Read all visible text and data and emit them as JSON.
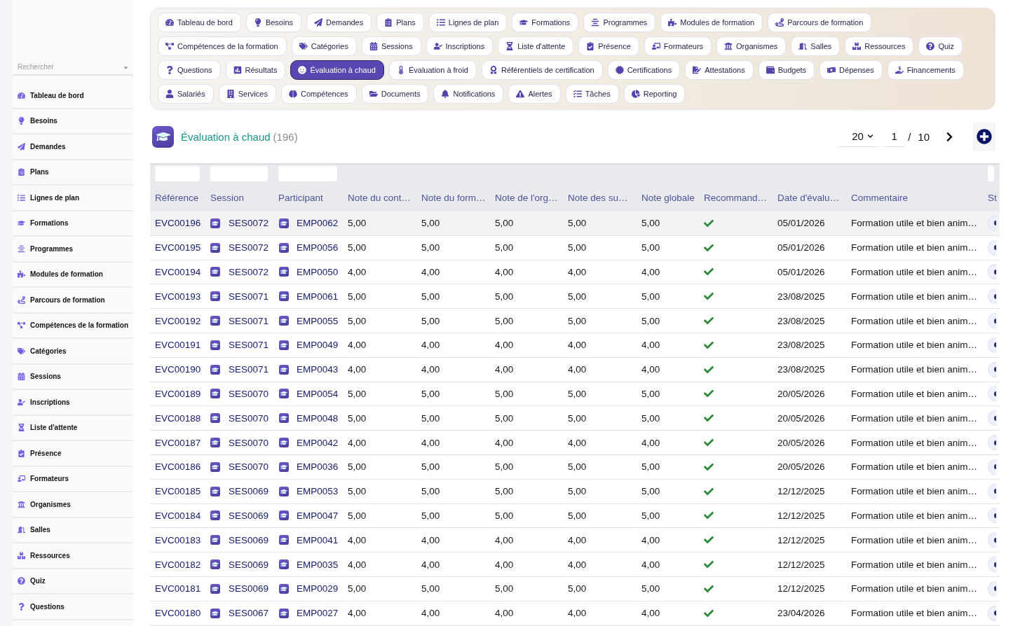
{
  "sidebar": {
    "search": {
      "placeholder": "Rechercher"
    },
    "items": [
      {
        "label": "Tableau de bord",
        "selected": false
      },
      {
        "label": "Besoins",
        "selected": false
      },
      {
        "label": "Demandes",
        "selected": false
      },
      {
        "label": "Plans",
        "selected": false
      },
      {
        "label": "Lignes de plan",
        "selected": false
      },
      {
        "label": "Formations",
        "selected": false
      },
      {
        "label": "Programmes",
        "selected": false
      },
      {
        "label": "Modules de formation",
        "selected": false
      },
      {
        "label": "Parcours de formation",
        "selected": false
      },
      {
        "label": "Compétences de la formation",
        "selected": false
      },
      {
        "label": "Catégories",
        "selected": false
      },
      {
        "label": "Sessions",
        "selected": false
      },
      {
        "label": "Inscriptions",
        "selected": false
      },
      {
        "label": "Liste d'attente",
        "selected": false
      },
      {
        "label": "Présence",
        "selected": false
      },
      {
        "label": "Formateurs",
        "selected": false
      },
      {
        "label": "Organismes",
        "selected": false
      },
      {
        "label": "Salles",
        "selected": false
      },
      {
        "label": "Ressources",
        "selected": false
      },
      {
        "label": "Quiz",
        "selected": false
      },
      {
        "label": "Questions",
        "selected": false
      }
    ]
  },
  "nav": {
    "items": [
      {
        "label": "Tableau de bord",
        "selected": false
      },
      {
        "label": "Besoins",
        "selected": false
      },
      {
        "label": "Demandes",
        "selected": false
      },
      {
        "label": "Plans",
        "selected": false
      },
      {
        "label": "Lignes de plan",
        "selected": false
      },
      {
        "label": "Formations",
        "selected": false
      },
      {
        "label": "Programmes",
        "selected": false
      },
      {
        "label": "Modules de formation",
        "selected": false
      },
      {
        "label": "Parcours de formation",
        "selected": false
      },
      {
        "label": "Compétences de la formation",
        "selected": false
      },
      {
        "label": "Catégories",
        "selected": false
      },
      {
        "label": "Sessions",
        "selected": false
      },
      {
        "label": "Inscriptions",
        "selected": false
      },
      {
        "label": "Liste d'attente",
        "selected": false
      },
      {
        "label": "Présence",
        "selected": false
      },
      {
        "label": "Formateurs",
        "selected": false
      },
      {
        "label": "Organismes",
        "selected": false
      },
      {
        "label": "Salles",
        "selected": false
      },
      {
        "label": "Ressources",
        "selected": false
      },
      {
        "label": "Quiz",
        "selected": false
      },
      {
        "label": "Questions",
        "selected": false
      },
      {
        "label": "Résultats",
        "selected": false
      },
      {
        "label": "Évaluation à chaud",
        "selected": true
      },
      {
        "label": "Évaluation à froid",
        "selected": false
      },
      {
        "label": "Référentiels de certification",
        "selected": false
      },
      {
        "label": "Certifications",
        "selected": false
      },
      {
        "label": "Attestations",
        "selected": false
      },
      {
        "label": "Budgets",
        "selected": false
      },
      {
        "label": "Dépenses",
        "selected": false
      },
      {
        "label": "Financements",
        "selected": false
      },
      {
        "label": "Salariés",
        "selected": false
      },
      {
        "label": "Services",
        "selected": false
      },
      {
        "label": "Compétences",
        "selected": false
      },
      {
        "label": "Documents",
        "selected": false
      },
      {
        "label": "Notifications",
        "selected": false
      },
      {
        "label": "Alertes",
        "selected": false
      },
      {
        "label": "Tâches",
        "selected": false
      },
      {
        "label": "Reporting",
        "selected": false
      }
    ]
  },
  "header": {
    "title": "Évaluation à chaud",
    "count": "(196)"
  },
  "pagination": {
    "page_size": "20",
    "page": "1",
    "separator": "/",
    "total_pages": "10"
  },
  "table": {
    "columns": [
      {
        "label": "Référence",
        "filter": true
      },
      {
        "label": "Session",
        "filter": true
      },
      {
        "label": "Participant",
        "filter": true
      },
      {
        "label": "Note du cont…",
        "filter": false
      },
      {
        "label": "Note du form…",
        "filter": false
      },
      {
        "label": "Note de l'org…",
        "filter": false
      },
      {
        "label": "Note des su…",
        "filter": false
      },
      {
        "label": "Note globale",
        "filter": false
      },
      {
        "label": "Recommand…",
        "filter": false
      },
      {
        "label": "Date d'évalu…",
        "filter": false
      },
      {
        "label": "Commentaire",
        "filter": false
      },
      {
        "label": "St",
        "filter": true
      }
    ],
    "rows": [
      {
        "reference": "EVC00196",
        "session": "SES0072",
        "participant": "EMP0062",
        "notes": [
          "5,00",
          "5,00",
          "5,00",
          "5,00"
        ],
        "global_note": "5,00",
        "recommended": true,
        "date": "05/01/2026",
        "comment": "Formation utile et bien anim…",
        "highlighted": true
      },
      {
        "reference": "EVC00195",
        "session": "SES0072",
        "participant": "EMP0056",
        "notes": [
          "5,00",
          "5,00",
          "5,00",
          "5,00"
        ],
        "global_note": "5,00",
        "recommended": true,
        "date": "05/01/2026",
        "comment": "Formation utile et bien anim…",
        "highlighted": false
      },
      {
        "reference": "EVC00194",
        "session": "SES0072",
        "participant": "EMP0050",
        "notes": [
          "4,00",
          "4,00",
          "4,00",
          "4,00"
        ],
        "global_note": "4,00",
        "recommended": true,
        "date": "05/01/2026",
        "comment": "Formation utile et bien anim…",
        "highlighted": false
      },
      {
        "reference": "EVC00193",
        "session": "SES0071",
        "participant": "EMP0061",
        "notes": [
          "5,00",
          "5,00",
          "5,00",
          "5,00"
        ],
        "global_note": "5,00",
        "recommended": true,
        "date": "23/08/2025",
        "comment": "Formation utile et bien anim…",
        "highlighted": false
      },
      {
        "reference": "EVC00192",
        "session": "SES0071",
        "participant": "EMP0055",
        "notes": [
          "5,00",
          "5,00",
          "5,00",
          "5,00"
        ],
        "global_note": "5,00",
        "recommended": true,
        "date": "23/08/2025",
        "comment": "Formation utile et bien anim…",
        "highlighted": false
      },
      {
        "reference": "EVC00191",
        "session": "SES0071",
        "participant": "EMP0049",
        "notes": [
          "4,00",
          "4,00",
          "4,00",
          "4,00"
        ],
        "global_note": "4,00",
        "recommended": true,
        "date": "23/08/2025",
        "comment": "Formation utile et bien anim…",
        "highlighted": false
      },
      {
        "reference": "EVC00190",
        "session": "SES0071",
        "participant": "EMP0043",
        "notes": [
          "4,00",
          "4,00",
          "4,00",
          "4,00"
        ],
        "global_note": "4,00",
        "recommended": true,
        "date": "23/08/2025",
        "comment": "Formation utile et bien anim…",
        "highlighted": false
      },
      {
        "reference": "EVC00189",
        "session": "SES0070",
        "participant": "EMP0054",
        "notes": [
          "5,00",
          "5,00",
          "5,00",
          "5,00"
        ],
        "global_note": "5,00",
        "recommended": true,
        "date": "20/05/2026",
        "comment": "Formation utile et bien anim…",
        "highlighted": false
      },
      {
        "reference": "EVC00188",
        "session": "SES0070",
        "participant": "EMP0048",
        "notes": [
          "5,00",
          "5,00",
          "5,00",
          "5,00"
        ],
        "global_note": "5,00",
        "recommended": true,
        "date": "20/05/2026",
        "comment": "Formation utile et bien anim…",
        "highlighted": false
      },
      {
        "reference": "EVC00187",
        "session": "SES0070",
        "participant": "EMP0042",
        "notes": [
          "4,00",
          "4,00",
          "4,00",
          "4,00"
        ],
        "global_note": "4,00",
        "recommended": true,
        "date": "20/05/2026",
        "comment": "Formation utile et bien anim…",
        "highlighted": false
      },
      {
        "reference": "EVC00186",
        "session": "SES0070",
        "participant": "EMP0036",
        "notes": [
          "5,00",
          "5,00",
          "5,00",
          "5,00"
        ],
        "global_note": "5,00",
        "recommended": true,
        "date": "20/05/2026",
        "comment": "Formation utile et bien anim…",
        "highlighted": false
      },
      {
        "reference": "EVC00185",
        "session": "SES0069",
        "participant": "EMP0053",
        "notes": [
          "5,00",
          "5,00",
          "5,00",
          "5,00"
        ],
        "global_note": "5,00",
        "recommended": true,
        "date": "12/12/2025",
        "comment": "Formation utile et bien anim…",
        "highlighted": false
      },
      {
        "reference": "EVC00184",
        "session": "SES0069",
        "participant": "EMP0047",
        "notes": [
          "5,00",
          "5,00",
          "5,00",
          "5,00"
        ],
        "global_note": "5,00",
        "recommended": true,
        "date": "12/12/2025",
        "comment": "Formation utile et bien anim…",
        "highlighted": false
      },
      {
        "reference": "EVC00183",
        "session": "SES0069",
        "participant": "EMP0041",
        "notes": [
          "4,00",
          "4,00",
          "4,00",
          "4,00"
        ],
        "global_note": "4,00",
        "recommended": true,
        "date": "12/12/2025",
        "comment": "Formation utile et bien anim…",
        "highlighted": false
      },
      {
        "reference": "EVC00182",
        "session": "SES0069",
        "participant": "EMP0035",
        "notes": [
          "4,00",
          "4,00",
          "4,00",
          "4,00"
        ],
        "global_note": "4,00",
        "recommended": true,
        "date": "12/12/2025",
        "comment": "Formation utile et bien anim…",
        "highlighted": false
      },
      {
        "reference": "EVC00181",
        "session": "SES0069",
        "participant": "EMP0029",
        "notes": [
          "5,00",
          "5,00",
          "5,00",
          "5,00"
        ],
        "global_note": "5,00",
        "recommended": true,
        "date": "12/12/2025",
        "comment": "Formation utile et bien anim…",
        "highlighted": false
      },
      {
        "reference": "EVC00180",
        "session": "SES0067",
        "participant": "EMP0027",
        "notes": [
          "4,00",
          "4,00",
          "4,00",
          "4,00"
        ],
        "global_note": "4,00",
        "recommended": true,
        "date": "23/04/2026",
        "comment": "Formation utile et bien anim…",
        "highlighted": false
      }
    ]
  }
}
